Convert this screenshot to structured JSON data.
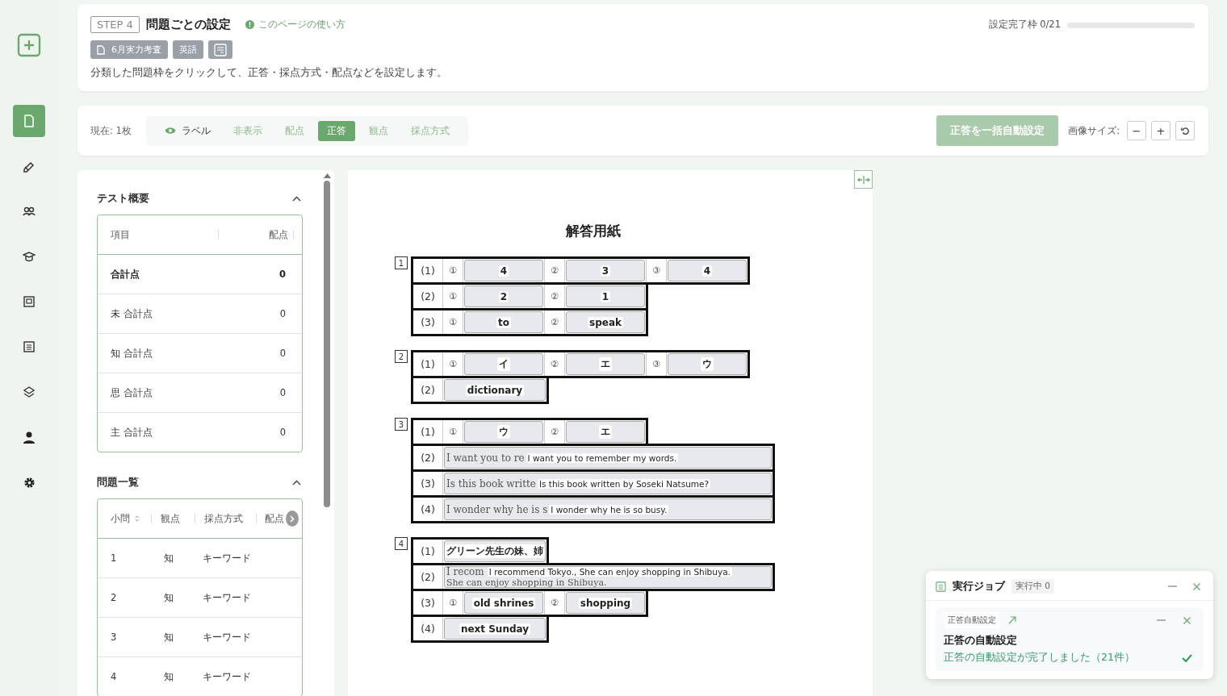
{
  "sidebar": {
    "items": [
      {
        "kind": "add",
        "selected": false
      },
      {
        "kind": "document",
        "selected": true
      },
      {
        "kind": "pen",
        "selected": false
      },
      {
        "kind": "group",
        "selected": false
      },
      {
        "kind": "cap",
        "selected": false
      },
      {
        "kind": "frame",
        "selected": false
      },
      {
        "kind": "list",
        "selected": false
      },
      {
        "kind": "stack",
        "selected": false
      },
      {
        "kind": "person",
        "selected": false
      },
      {
        "kind": "gear",
        "selected": false
      }
    ]
  },
  "header": {
    "step": "STEP 4",
    "title": "問題ごとの設定",
    "help_link": "このページの使い方",
    "tags": [
      {
        "kind": "test",
        "label": "6月実力考査"
      },
      {
        "kind": "subject",
        "label": "英語"
      },
      {
        "kind": "sheet"
      }
    ],
    "description": "分類した問題枠をクリックして、正答・採点方式・配点などを設定します。",
    "progress": {
      "label": "設定完了枠 0/21",
      "level": 0
    }
  },
  "toolbar": {
    "count": "現在: 1枚",
    "modes": [
      {
        "kind": "toggle",
        "label": "ラベル",
        "selected": false
      },
      {
        "kind": "mode",
        "label": "非表示",
        "selected": false
      },
      {
        "kind": "mode",
        "label": "配点",
        "selected": false
      },
      {
        "kind": "mode",
        "label": "正答",
        "selected": true
      },
      {
        "kind": "mode",
        "label": "観点",
        "selected": false
      },
      {
        "kind": "mode",
        "label": "採点方式",
        "selected": false
      }
    ],
    "auto_button": {
      "label": "正答を一括自動設定",
      "disabled": true
    },
    "image_size": {
      "label": "画像サイズ:",
      "buttons": [
        "−",
        "+"
      ]
    }
  },
  "summary": {
    "title": "テスト概要",
    "expanded": true,
    "columns": [
      "項目",
      "配点"
    ],
    "rows": [
      {
        "item": "合計点",
        "points": "0",
        "total": true
      },
      {
        "item": "未 合計点",
        "points": "0",
        "total": false
      },
      {
        "item": "知 合計点",
        "points": "0",
        "total": false
      },
      {
        "item": "思 合計点",
        "points": "0",
        "total": false
      },
      {
        "item": "主 合計点",
        "points": "0",
        "total": false
      }
    ]
  },
  "questions": {
    "title": "問題一覧",
    "expanded": true,
    "columns": [
      "小問",
      "観点",
      "採点方式",
      "配点"
    ],
    "rows": [
      {
        "no": "1",
        "viewpoint": "知",
        "method": "キーワード"
      },
      {
        "no": "2",
        "viewpoint": "知",
        "method": "キーワード"
      },
      {
        "no": "3",
        "viewpoint": "知",
        "method": "キーワード"
      },
      {
        "no": "4",
        "viewpoint": "知",
        "method": "キーワード"
      }
    ]
  },
  "sheet": {
    "title": "解答用紙",
    "sections": [
      {
        "number": "1",
        "rows": [
          {
            "label": "(1)",
            "cells": [
              {
                "kind": "num",
                "text": "①"
              },
              {
                "kind": "answer",
                "value": "4"
              },
              {
                "kind": "num",
                "text": "②"
              },
              {
                "kind": "answer",
                "value": "3"
              },
              {
                "kind": "num",
                "text": "③"
              },
              {
                "kind": "answer",
                "value": "4"
              }
            ]
          },
          {
            "label": "(2)",
            "cells": [
              {
                "kind": "num",
                "text": "①"
              },
              {
                "kind": "answer",
                "value": "2"
              },
              {
                "kind": "num",
                "text": "②"
              },
              {
                "kind": "answer",
                "value": "1"
              }
            ]
          },
          {
            "label": "(3)",
            "cells": [
              {
                "kind": "num",
                "text": "①"
              },
              {
                "kind": "answer",
                "value": "to"
              },
              {
                "kind": "num",
                "text": "②"
              },
              {
                "kind": "answer",
                "value": "speak"
              }
            ]
          }
        ]
      },
      {
        "number": "2",
        "rows": [
          {
            "label": "(1)",
            "cells": [
              {
                "kind": "num",
                "text": "①"
              },
              {
                "kind": "answer",
                "value": "イ"
              },
              {
                "kind": "num",
                "text": "②"
              },
              {
                "kind": "answer",
                "value": "エ"
              },
              {
                "kind": "num",
                "text": "③"
              },
              {
                "kind": "answer",
                "value": "ウ"
              }
            ]
          },
          {
            "label": "(2)",
            "cells": [
              {
                "kind": "answer",
                "value": "dictionary",
                "colspan": 2
              }
            ]
          }
        ]
      },
      {
        "number": "3",
        "rows": [
          {
            "label": "(1)",
            "cells": [
              {
                "kind": "num",
                "text": "①"
              },
              {
                "kind": "answer",
                "value": "ウ"
              },
              {
                "kind": "num",
                "text": "②"
              },
              {
                "kind": "answer",
                "value": "エ"
              }
            ]
          },
          {
            "label": "(2)",
            "cells": [
              {
                "kind": "answer",
                "base": [
                  "I want you to re"
                ],
                "value": "I want you to remember my words."
              }
            ]
          },
          {
            "label": "(3)",
            "cells": [
              {
                "kind": "answer",
                "base": [
                  "Is this book writte"
                ],
                "value": "Is this book written by Soseki Natsume?"
              }
            ]
          },
          {
            "label": "(4)",
            "cells": [
              {
                "kind": "answer",
                "base": [
                  "I wonder why he is s"
                ],
                "value": "I wonder why he is so busy."
              }
            ]
          }
        ]
      },
      {
        "number": "4",
        "rows": [
          {
            "label": "(1)",
            "cells": [
              {
                "kind": "answer",
                "value": "グリーン先生の妹、姉",
                "colspan": 2
              }
            ]
          },
          {
            "label": "(2)",
            "cells": [
              {
                "kind": "answer",
                "base": [
                  "I recom",
                  "She can enjoy shopping in Shibuya."
                ],
                "value": "I recommend Tokyo., She can enjoy shopping in Shibuya."
              }
            ]
          },
          {
            "label": "(3)",
            "cells": [
              {
                "kind": "num",
                "text": "①"
              },
              {
                "kind": "answer",
                "value": "old shrines"
              },
              {
                "kind": "num",
                "text": "②"
              },
              {
                "kind": "answer",
                "value": "shopping"
              }
            ]
          },
          {
            "label": "(4)",
            "cells": [
              {
                "kind": "answer",
                "value": "next Sunday",
                "colspan": 2
              }
            ]
          }
        ]
      }
    ]
  },
  "jobs": {
    "title": "実行ジョブ",
    "running": "実行中 0",
    "items": [
      {
        "tag": "正答自動設定",
        "title": "正答の自動設定",
        "message": "正答の自動設定が完了しました（21件）",
        "done": true
      }
    ]
  }
}
